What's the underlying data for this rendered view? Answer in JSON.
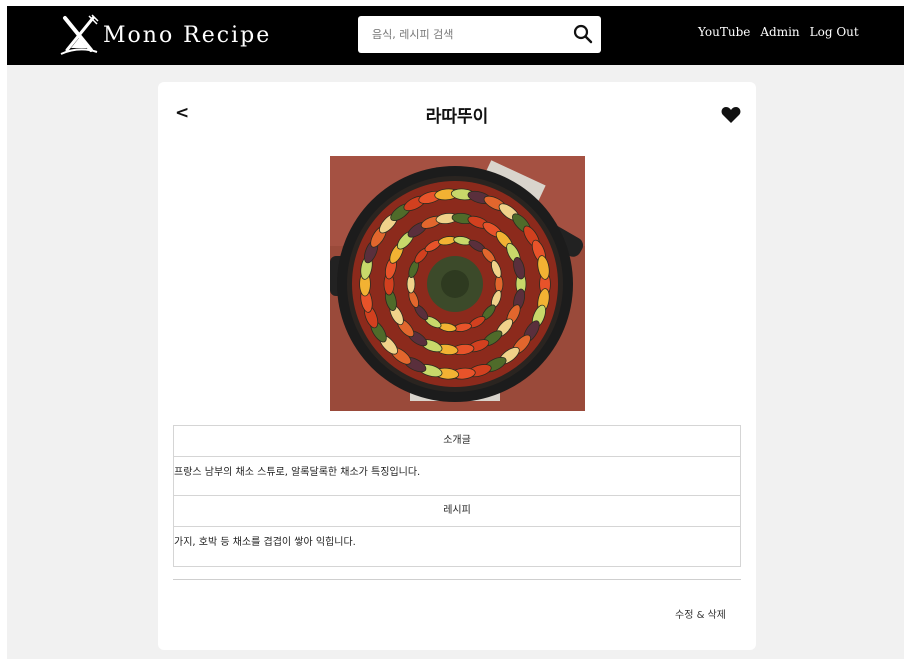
{
  "navbar": {
    "brand": "Mono Recipe",
    "logo_icon": "cross-utensils-logo",
    "search": {
      "placeholder": "음식, 레시피 검색",
      "value": ""
    },
    "links": [
      "YouTube",
      "Admin",
      "Log Out"
    ]
  },
  "recipe": {
    "title": "라따뚜이",
    "back_label": "<",
    "image_alt": "ratatouille in cast iron skillet",
    "sections": [
      {
        "heading": "소개글",
        "content": "프랑스 남부의 채소 스튜로, 알록달록한 채소가 특징입니다."
      },
      {
        "heading": "레시피",
        "content": "가지, 호박 등 채소를 겹겹이 쌓아 익힙니다."
      }
    ],
    "edit_delete_label": "수정 & 삭제"
  },
  "colors": {
    "navbar_bg": "#000000",
    "page_bg": "#f1f1f1",
    "card_bg": "#ffffff"
  }
}
